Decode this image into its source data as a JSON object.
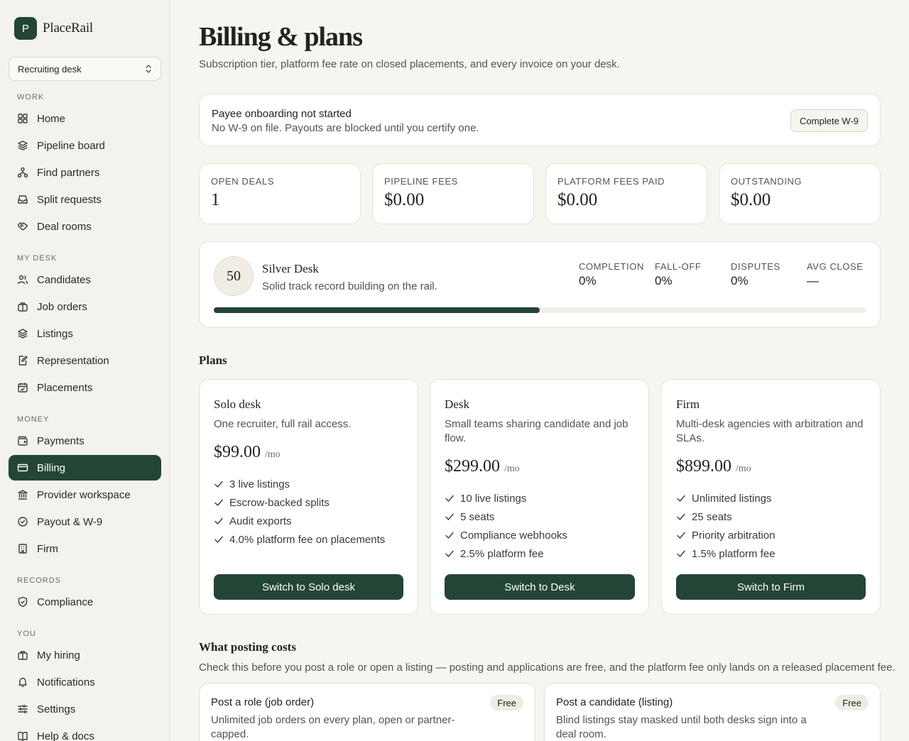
{
  "brand": {
    "mark": "P",
    "name": "PlaceRail"
  },
  "desk_selector": {
    "value": "Recruiting desk"
  },
  "sidebar": {
    "sections": {
      "work": "WORK",
      "my_desk": "MY DESK",
      "money": "MONEY",
      "records": "RECORDS",
      "you": "YOU"
    },
    "items": {
      "home": "Home",
      "pipeline": "Pipeline board",
      "partners": "Find partners",
      "splits": "Split requests",
      "deals": "Deal rooms",
      "candidates": "Candidates",
      "jobs": "Job orders",
      "listings": "Listings",
      "representation": "Representation",
      "placements": "Placements",
      "payments": "Payments",
      "billing": "Billing",
      "provider": "Provider workspace",
      "payout": "Payout & W-9",
      "firm": "Firm",
      "compliance": "Compliance",
      "hiring": "My hiring",
      "notifications": "Notifications",
      "settings": "Settings",
      "help": "Help & docs"
    },
    "active": "billing"
  },
  "header": {
    "title": "Billing & plans",
    "subtitle": "Subscription tier, platform fee rate on closed placements, and every invoice on your desk."
  },
  "banner": {
    "title": "Payee onboarding not started",
    "text": "No W-9 on file. Payouts are blocked until you certify one.",
    "button": "Complete W-9"
  },
  "stats": [
    {
      "label": "OPEN DEALS",
      "value": "1"
    },
    {
      "label": "PIPELINE FEES",
      "value": "$0.00"
    },
    {
      "label": "PLATFORM FEES PAID",
      "value": "$0.00"
    },
    {
      "label": "OUTSTANDING",
      "value": "$0.00"
    }
  ],
  "tier": {
    "score": "50",
    "name": "Silver Desk",
    "description": "Solid track record building on the rail.",
    "progress": 0.5,
    "metrics": [
      {
        "label": "COMPLETION",
        "value": "0%"
      },
      {
        "label": "FALL-OFF",
        "value": "0%"
      },
      {
        "label": "DISPUTES",
        "value": "0%"
      },
      {
        "label": "AVG CLOSE",
        "value": "—"
      }
    ]
  },
  "plans_section": {
    "title": "Plans",
    "per": "/mo",
    "plans": [
      {
        "name": "Solo desk",
        "description": "One recruiter, full rail access.",
        "price": "$99.00",
        "features": [
          "3 live listings",
          "Escrow-backed splits",
          "Audit exports",
          "4.0% platform fee on placements"
        ],
        "button": "Switch to Solo desk"
      },
      {
        "name": "Desk",
        "description": "Small teams sharing candidate and job flow.",
        "price": "$299.00",
        "features": [
          "10 live listings",
          "5 seats",
          "Compliance webhooks",
          "2.5% platform fee"
        ],
        "button": "Switch to Desk"
      },
      {
        "name": "Firm",
        "description": "Multi-desk agencies with arbitration and SLAs.",
        "price": "$899.00",
        "features": [
          "Unlimited listings",
          "25 seats",
          "Priority arbitration",
          "1.5% platform fee"
        ],
        "button": "Switch to Firm"
      }
    ]
  },
  "posting": {
    "title": "What posting costs",
    "subtitle": "Check this before you post a role or open a listing — posting and applications are free, and the platform fee only lands on a released placement fee.",
    "cards": [
      {
        "title": "Post a role (job order)",
        "badge": "Free",
        "description": "Unlimited job orders on every plan, open or partner-capped."
      },
      {
        "title": "Post a candidate (listing)",
        "badge": "Free",
        "description": "Blind listings stay masked until both desks sign into a deal room."
      }
    ]
  },
  "colors": {
    "accent": "#234536",
    "background": "#f7f5ef",
    "sidebar": "#f4f2ec"
  }
}
